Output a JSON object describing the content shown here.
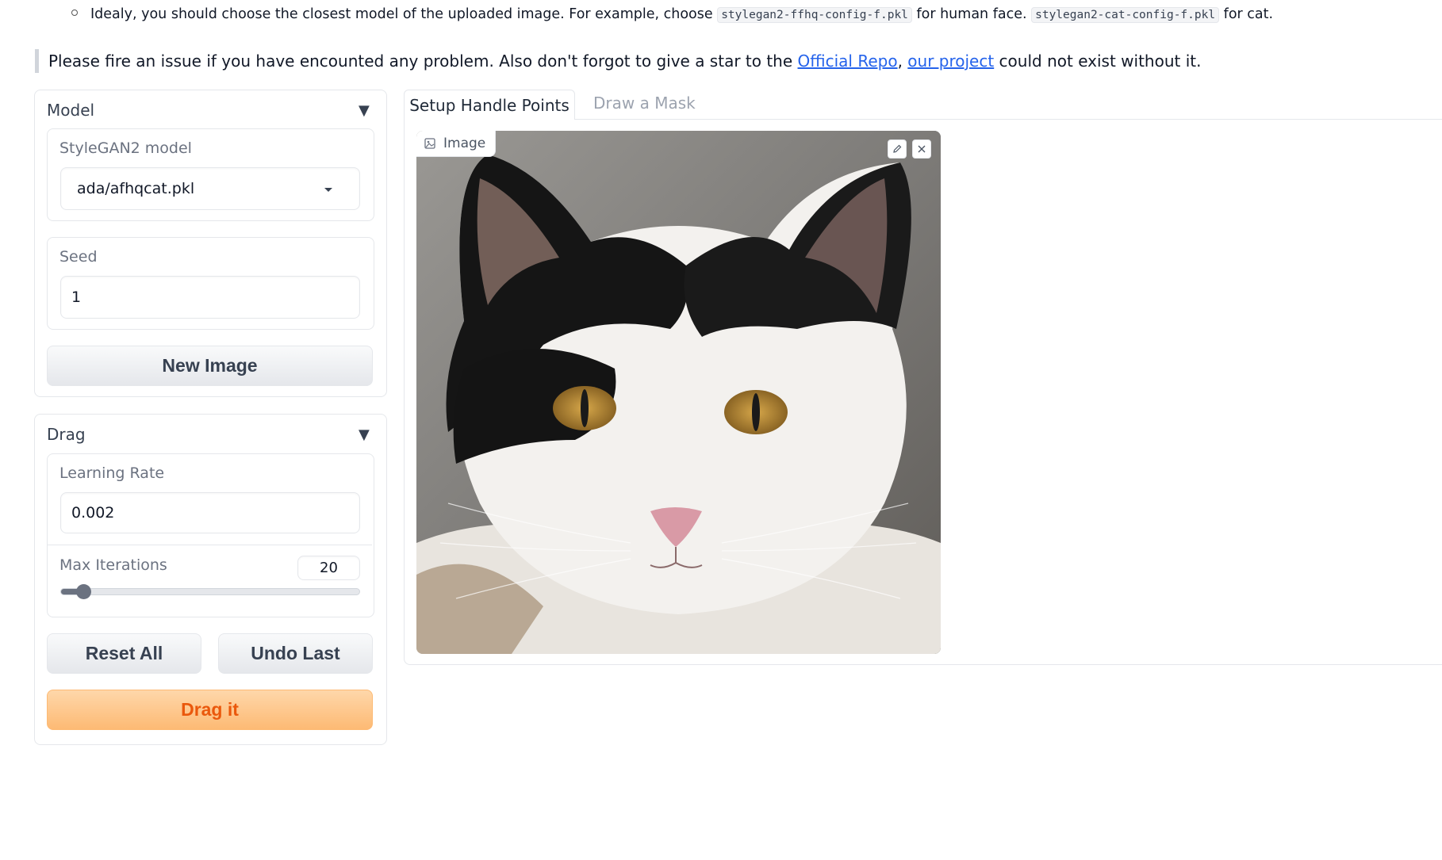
{
  "intro": {
    "bullet_text_1": "Idealy, you should choose the closest model of the uploaded image. For example, choose ",
    "code_1": "stylegan2-ffhq-config-f.pkl",
    "bullet_text_2": " for human face. ",
    "code_2": "stylegan2-cat-config-f.pkl",
    "bullet_text_3": " for cat.",
    "quote_text_1": "Please fire an issue if you have encounted any problem. Also don't forgot to give a star to the ",
    "quote_link_1": "Official Repo",
    "quote_sep": ", ",
    "quote_link_2": "our project",
    "quote_text_2": " could not exist without it."
  },
  "model_panel": {
    "title": "Model",
    "caret": "▼",
    "model_label": "StyleGAN2 model",
    "model_value": "ada/afhqcat.pkl",
    "seed_label": "Seed",
    "seed_value": "1",
    "new_image_button": "New Image"
  },
  "drag_panel": {
    "title": "Drag",
    "caret": "▼",
    "lr_label": "Learning Rate",
    "lr_value": "0.002",
    "iter_label": "Max Iterations",
    "iter_value": "20",
    "iter_slider_fraction": 0.05,
    "reset_button": "Reset All",
    "undo_button": "Undo Last",
    "drag_button": "Drag it"
  },
  "tabs": [
    {
      "label": "Setup Handle Points",
      "active": true
    },
    {
      "label": "Draw a Mask",
      "active": false
    }
  ],
  "image": {
    "label": "Image",
    "icon": "image-icon",
    "edit_icon": "pencil-icon",
    "clear_icon": "close-icon"
  },
  "colors": {
    "primary_button": "#fdba74",
    "primary_text": "#ea580c",
    "link": "#2563eb"
  }
}
